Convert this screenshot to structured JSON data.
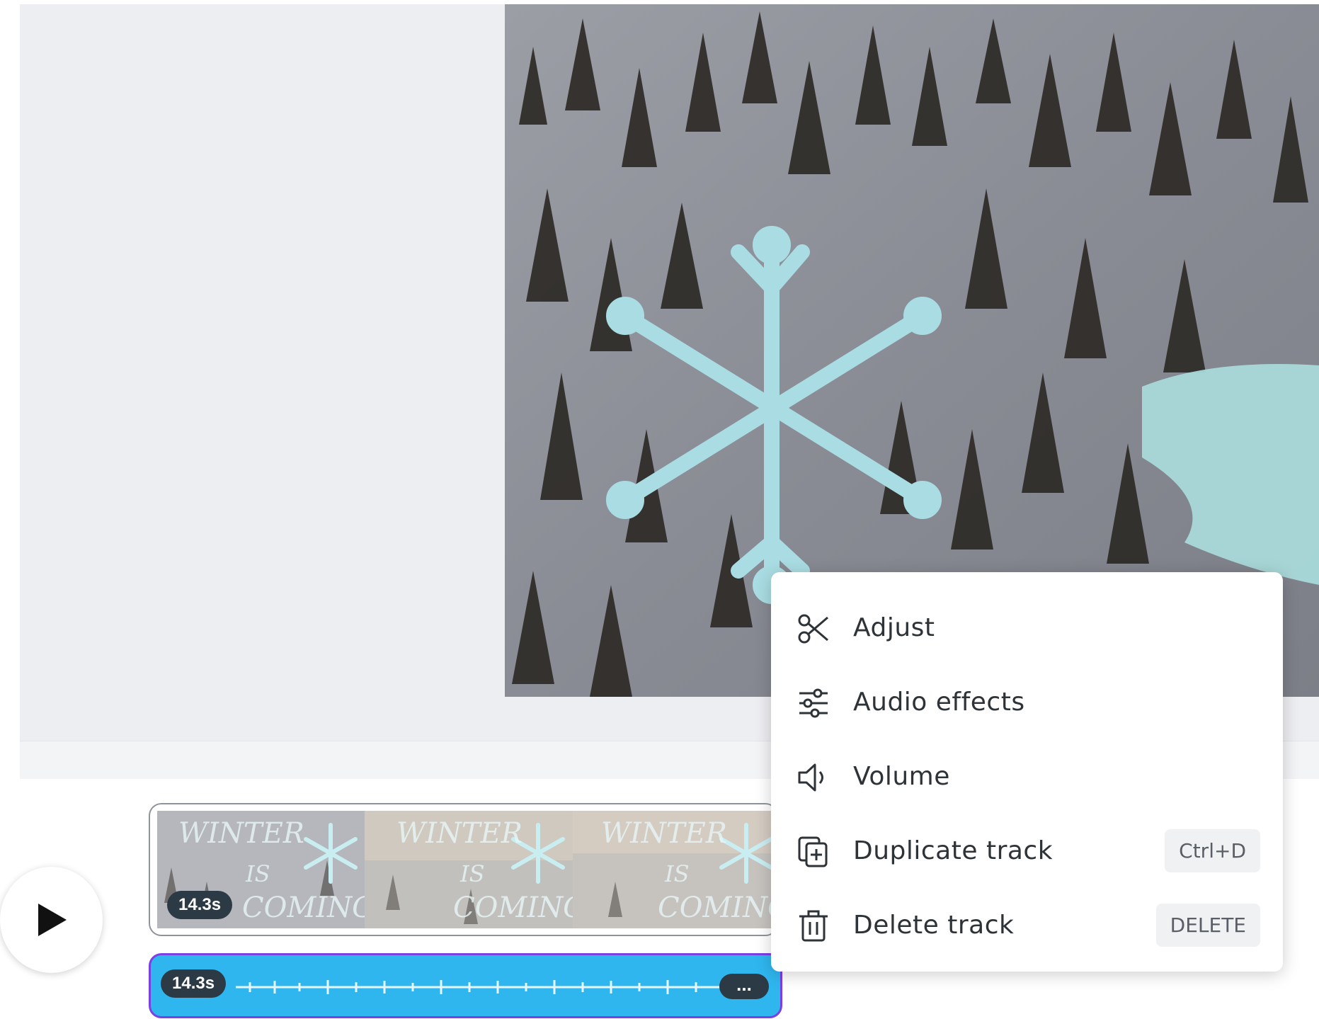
{
  "canvas": {
    "content": "winter-forest-video-with-snowflake-graphic"
  },
  "timeline": {
    "play_icon": "play-icon",
    "video_track": {
      "duration": "14.3s",
      "frame_text": "WINTER IS COMING",
      "frames": 3
    },
    "audio_track": {
      "duration": "14.3s",
      "more_label": "..."
    }
  },
  "context_menu": {
    "items": [
      {
        "label": "Adjust",
        "icon": "scissors-icon",
        "shortcut": ""
      },
      {
        "label": "Audio effects",
        "icon": "sliders-icon",
        "shortcut": ""
      },
      {
        "label": "Volume",
        "icon": "speaker-icon",
        "shortcut": ""
      },
      {
        "label": "Duplicate track",
        "icon": "duplicate-icon",
        "shortcut": "Ctrl+D"
      },
      {
        "label": "Delete track",
        "icon": "trash-icon",
        "shortcut": "DELETE"
      }
    ]
  },
  "colors": {
    "audio_track": "#2fb6ef",
    "audio_track_border": "#7b3fe4",
    "badge": "#2b3a45",
    "snowflake": "#a9dde3"
  }
}
